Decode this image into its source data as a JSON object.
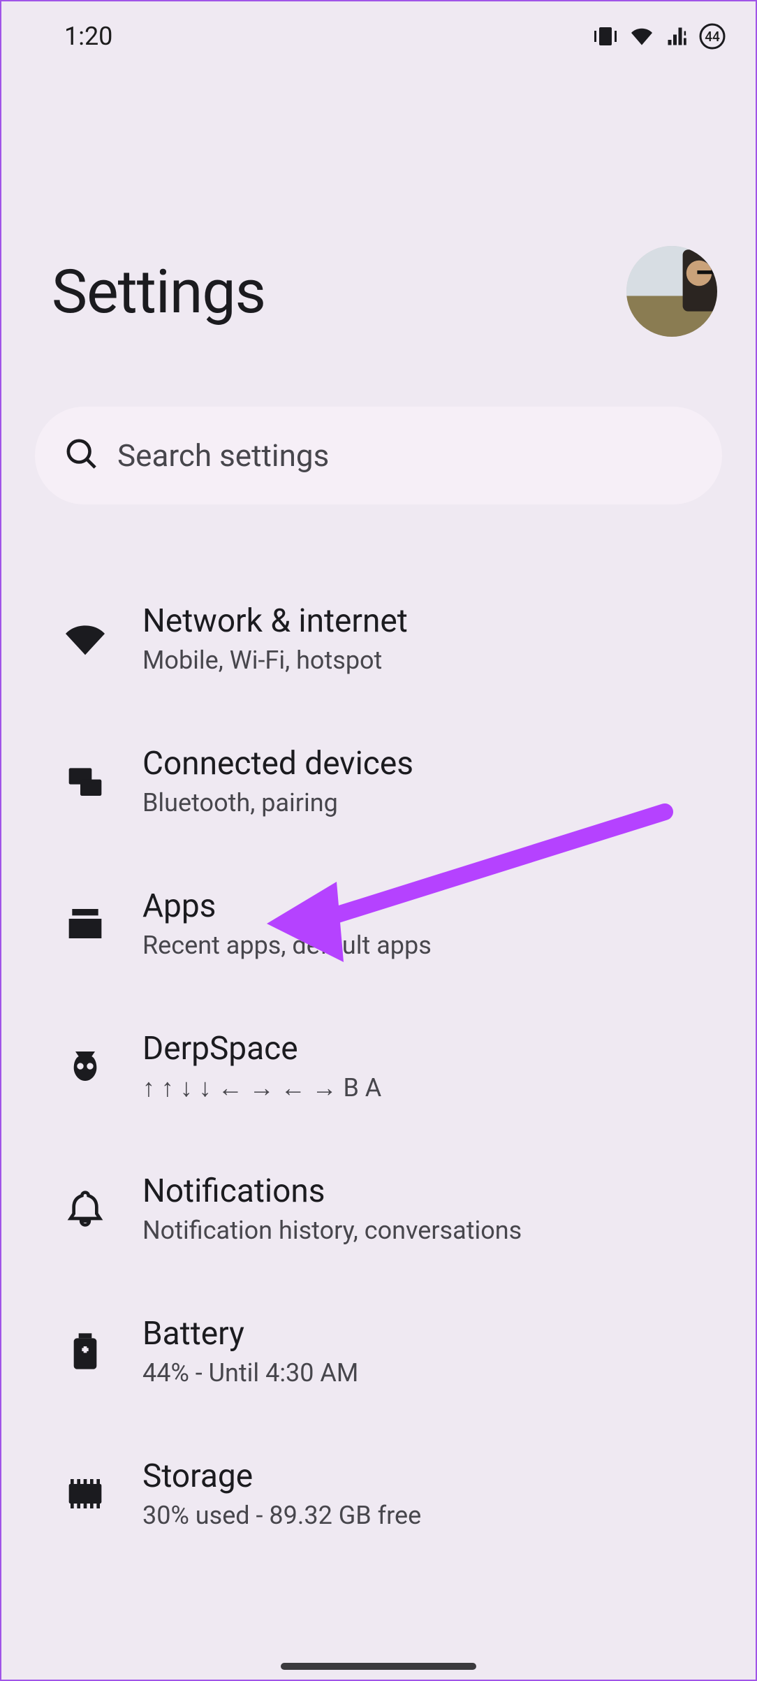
{
  "status": {
    "time": "1:20",
    "battery_badge": "44"
  },
  "header": {
    "title": "Settings"
  },
  "search": {
    "placeholder": "Search settings"
  },
  "items": [
    {
      "icon": "wifi-icon",
      "title": "Network & internet",
      "sub": "Mobile, Wi-Fi, hotspot"
    },
    {
      "icon": "devices-icon",
      "title": "Connected devices",
      "sub": "Bluetooth, pairing"
    },
    {
      "icon": "apps-icon",
      "title": "Apps",
      "sub": "Recent apps, default apps"
    },
    {
      "icon": "owl-icon",
      "title": "DerpSpace",
      "sub": "↑ ↑ ↓ ↓ ← → ← → B A"
    },
    {
      "icon": "bell-icon",
      "title": "Notifications",
      "sub": "Notification history, conversations"
    },
    {
      "icon": "battery-icon",
      "title": "Battery",
      "sub": "44% - Until 4:30 AM"
    },
    {
      "icon": "storage-icon",
      "title": "Storage",
      "sub": "30% used - 89.32 GB free"
    }
  ],
  "annotation": {
    "target_item_index": 2,
    "color": "#b542ff"
  }
}
